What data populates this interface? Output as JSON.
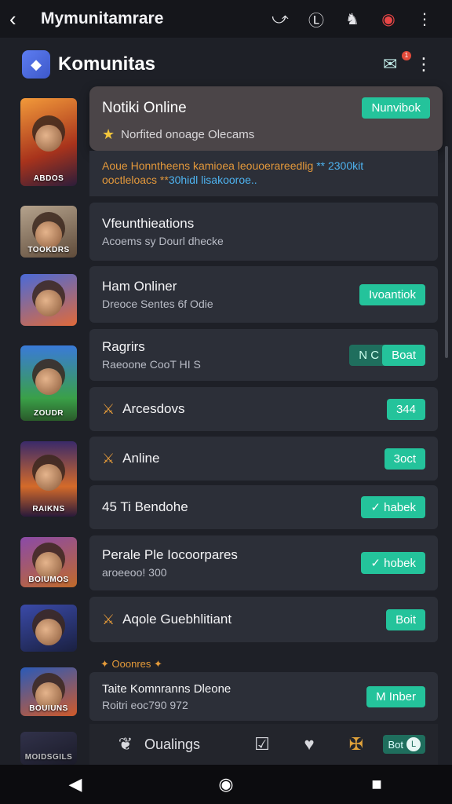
{
  "topbar": {
    "back_icon": "back-arrow-icon",
    "title": "Mymunitamrare",
    "icons": [
      "share-icon",
      "coin-icon",
      "mask-icon",
      "notification-icon",
      "more-icon"
    ]
  },
  "header": {
    "title": "Komunitas",
    "badge": "1"
  },
  "featured": {
    "name": "Notiki Online",
    "button": "Nunvibok",
    "subtitle": "Norfited onoage Olecams",
    "desc_line1_a": "Aoue Honntheens kamioea leouoerareedlig",
    "desc_line1_b": "** 2300kit",
    "desc_line2_a": "ooctleloacs **",
    "desc_line2_b": "30hidl lisakooroe.."
  },
  "thumbs": [
    {
      "label": "ABDOS",
      "color": "#c45a28"
    },
    {
      "label": "TOOKDRS",
      "color": "#6a5a4a"
    },
    {
      "label": "",
      "color": "#3b4a8a"
    },
    {
      "label": "ZOUDR",
      "color": "#2f7a3a"
    },
    {
      "label": "RAIKNS",
      "color": "#4c3a7a"
    },
    {
      "label": "BOIUMOS",
      "color": "#6a3a20"
    },
    {
      "label": "",
      "color": "#2c3a6a"
    },
    {
      "label": "BOUIUNS",
      "color": "#254f8f"
    },
    {
      "label": "MOIDSGILS",
      "color": "#3a3a4a"
    }
  ],
  "items": [
    {
      "title": "Vfeunthieations",
      "subtitle": "Acoems sy Dourl dhecke",
      "button": ""
    },
    {
      "title": "Ham Onliner",
      "subtitle": "Dreoce Sentes 6f Odie",
      "button": "Ivoantiok"
    },
    {
      "title": "Ragrirs",
      "subtitle": "Raeoone CooT HI S",
      "button": "Boat",
      "ghost": "N C"
    },
    {
      "title": "Arcesdovs",
      "subtitle": "",
      "button": "344"
    },
    {
      "title": "Anline",
      "subtitle": "",
      "button": "3oct"
    },
    {
      "title": "45  Ti Bendohe",
      "subtitle": "",
      "button": "✓ habek"
    },
    {
      "title": "Perale Ple Iocoorpares",
      "subtitle": "aroeeoo! 300",
      "button": "✓ hobek"
    },
    {
      "title": "Aqole Guebhlitiant",
      "subtitle": "",
      "button": "Boit"
    },
    {
      "title": "Taite Komnranns Dleone",
      "subtitle": "Roitri eoc790 972",
      "button": "M Inber"
    }
  ],
  "section": {
    "label": "Ooonres"
  },
  "bottomnav": {
    "label": "Oualings",
    "pill": "Bot",
    "clock": "L"
  }
}
